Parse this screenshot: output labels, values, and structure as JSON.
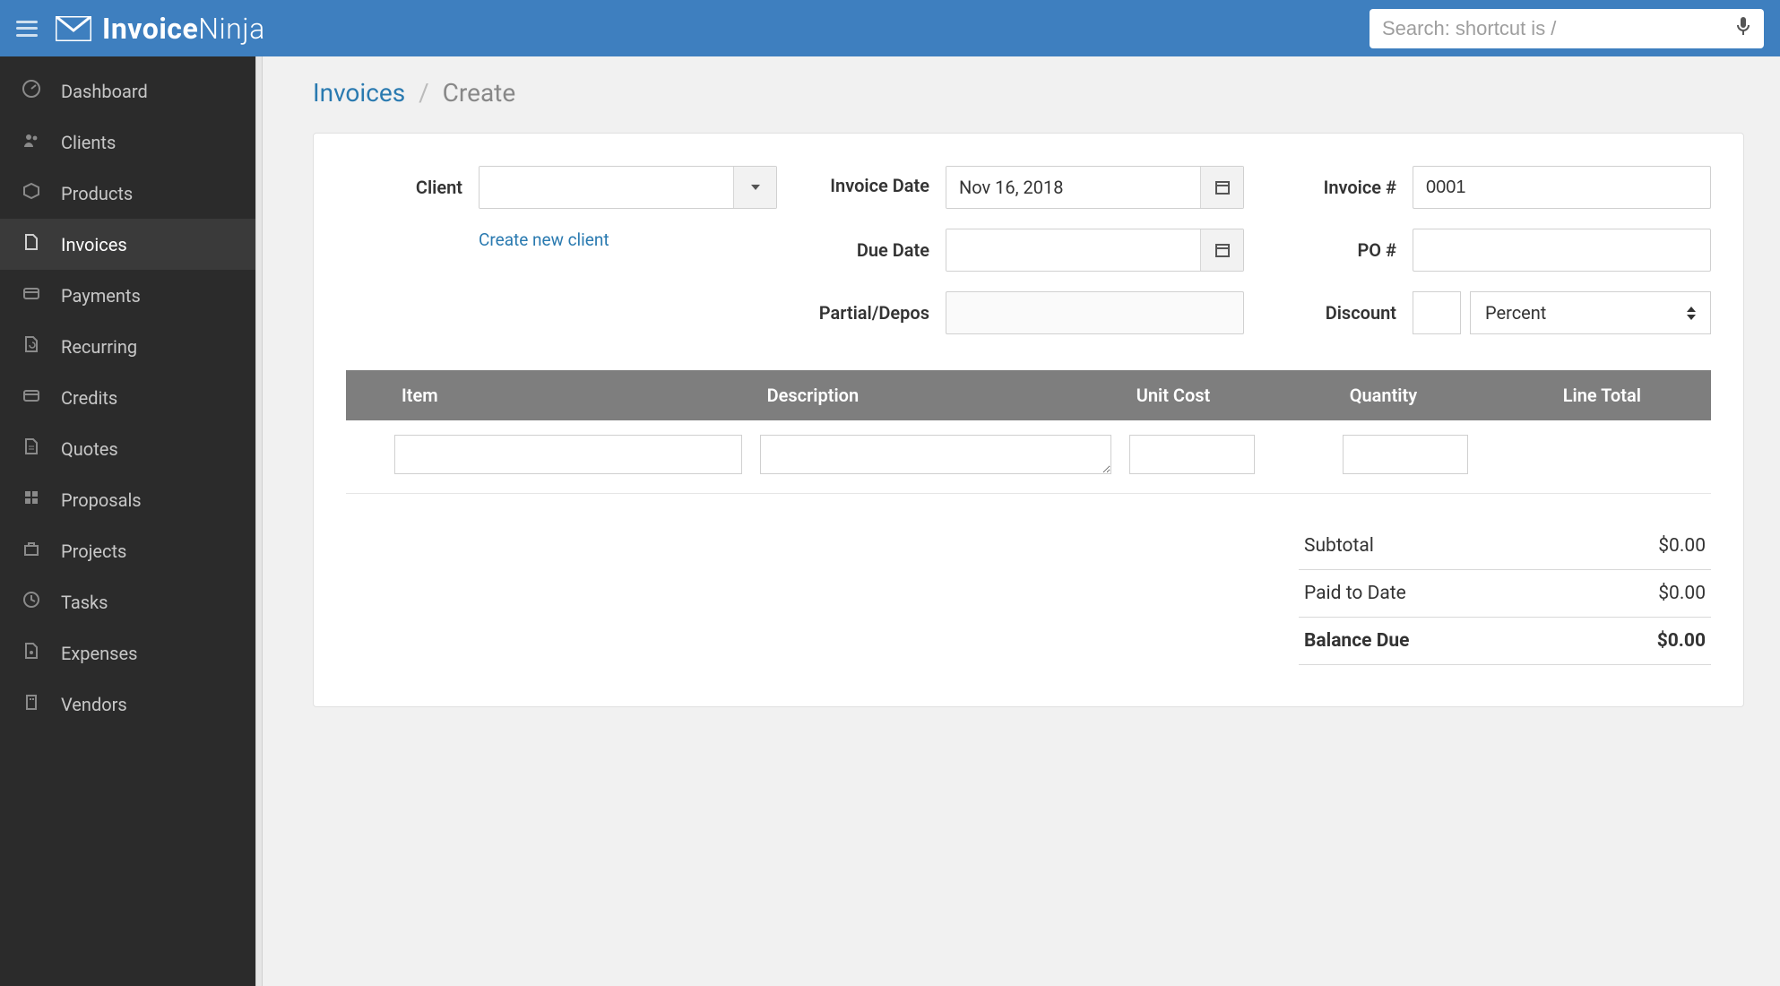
{
  "brand": {
    "strong": "Invoice",
    "light": "Ninja"
  },
  "search": {
    "placeholder": "Search: shortcut is /"
  },
  "sidebar": {
    "items": [
      {
        "label": "Dashboard"
      },
      {
        "label": "Clients"
      },
      {
        "label": "Products"
      },
      {
        "label": "Invoices"
      },
      {
        "label": "Payments"
      },
      {
        "label": "Recurring"
      },
      {
        "label": "Credits"
      },
      {
        "label": "Quotes"
      },
      {
        "label": "Proposals"
      },
      {
        "label": "Projects"
      },
      {
        "label": "Tasks"
      },
      {
        "label": "Expenses"
      },
      {
        "label": "Vendors"
      }
    ],
    "active_index": 3
  },
  "breadcrumb": {
    "root": "Invoices",
    "current": "Create"
  },
  "form": {
    "client_label": "Client",
    "client_value": "",
    "create_client_link": "Create new client",
    "invoice_date_label": "Invoice Date",
    "invoice_date_value": "Nov 16, 2018",
    "due_date_label": "Due Date",
    "due_date_value": "",
    "partial_label": "Partial/Depos",
    "partial_value": "",
    "invoice_number_label": "Invoice #",
    "invoice_number_value": "0001",
    "po_number_label": "PO #",
    "po_number_value": "",
    "discount_label": "Discount",
    "discount_value": "",
    "discount_type": "Percent"
  },
  "itemsTable": {
    "headers": {
      "item": "Item",
      "description": "Description",
      "unit_cost": "Unit Cost",
      "quantity": "Quantity",
      "line_total": "Line Total"
    }
  },
  "totals": {
    "subtotal_label": "Subtotal",
    "subtotal_value": "$0.00",
    "paid_label": "Paid to Date",
    "paid_value": "$0.00",
    "balance_label": "Balance Due",
    "balance_value": "$0.00"
  }
}
